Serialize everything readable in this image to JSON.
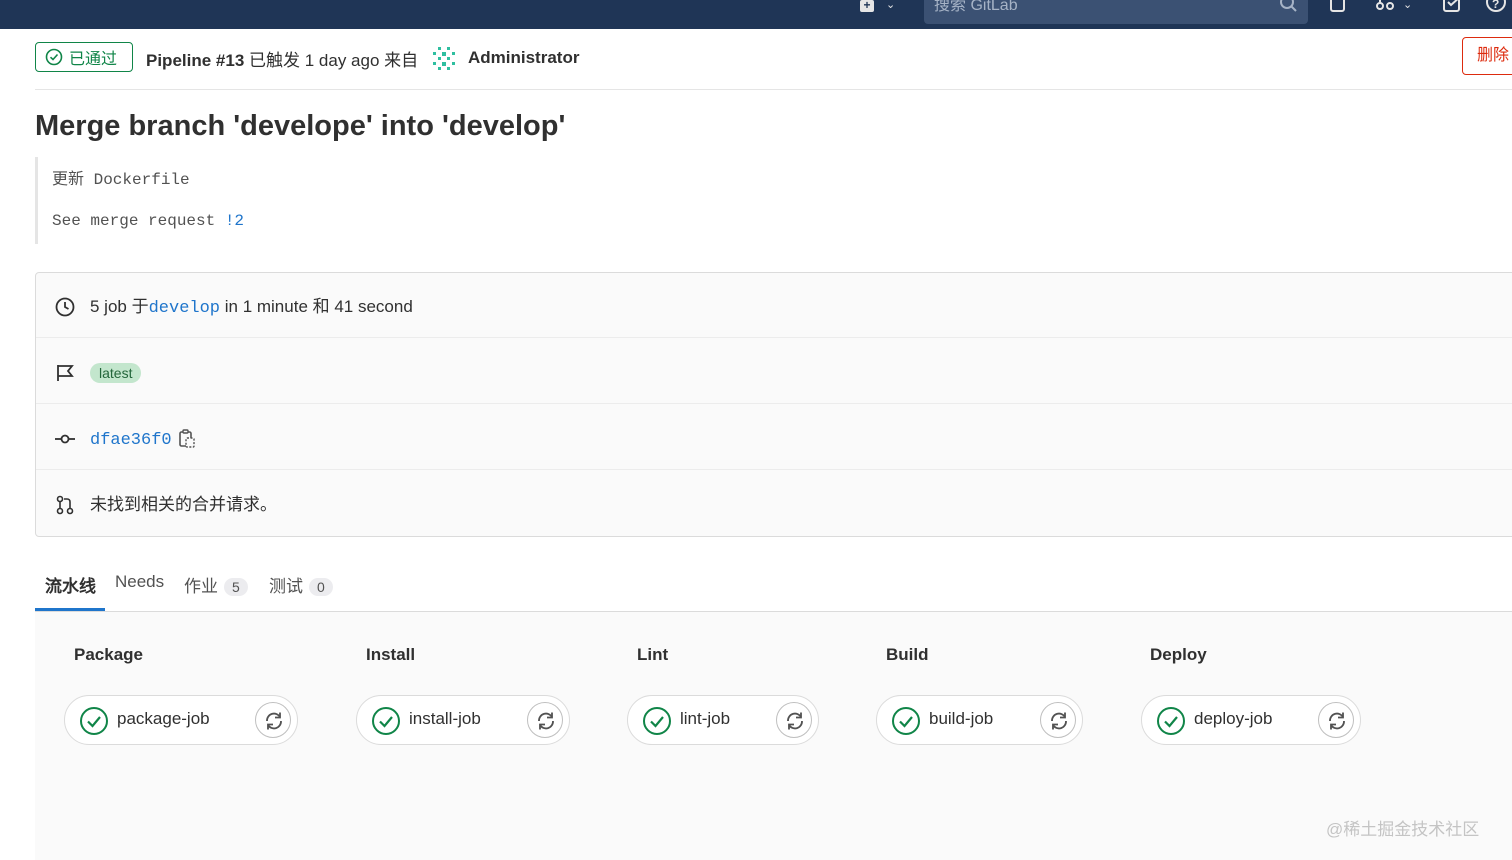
{
  "navbar": {
    "search_placeholder": "搜索 GitLab"
  },
  "header": {
    "status": "已通过",
    "pipeline_id": "Pipeline #13",
    "triggered_text": "已触发 1 day ago 来自",
    "user": "Administrator",
    "delete_label": "删除"
  },
  "commit": {
    "title": "Merge branch 'develope' into 'develop'",
    "message_line1": "更新 Dockerfile",
    "message_line2_prefix": "See merge request ",
    "mr_ref": "!2"
  },
  "info": {
    "jobs_prefix": "5 job 于",
    "branch": "develop",
    "duration": " in 1 minute 和 41 second",
    "tag": "latest",
    "sha": "dfae36f0",
    "mr_text": "未找到相关的合并请求。"
  },
  "tabs": [
    {
      "label": "流水线"
    },
    {
      "label": "Needs"
    },
    {
      "label": "作业",
      "count": "5"
    },
    {
      "label": "测试",
      "count": "0"
    }
  ],
  "stages": [
    {
      "title": "Package",
      "job": "package-job"
    },
    {
      "title": "Install",
      "job": "install-job"
    },
    {
      "title": "Lint",
      "job": "lint-job"
    },
    {
      "title": "Build",
      "job": "build-job"
    },
    {
      "title": "Deploy",
      "job": "deploy-job"
    }
  ],
  "colors": {
    "navbar": "#1f3556",
    "success": "#108548",
    "danger": "#dd2b0e",
    "link": "#1f75cb"
  },
  "watermark": "@稀土掘金技术社区"
}
